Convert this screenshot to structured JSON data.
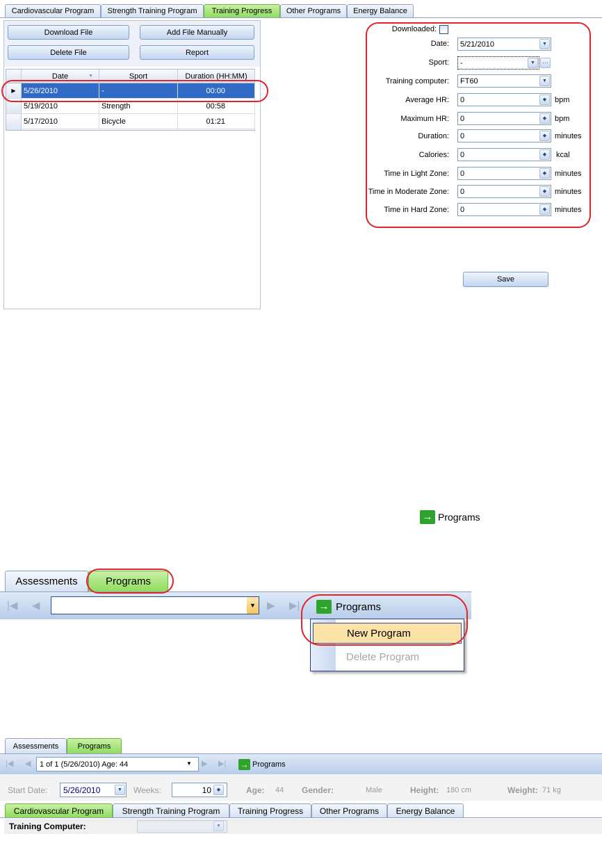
{
  "top": {
    "tabs": [
      {
        "label": "Cardiovascular Program",
        "active": false
      },
      {
        "label": "Strength Training Program",
        "active": false
      },
      {
        "label": "Training Progress",
        "active": true
      },
      {
        "label": "Other Programs",
        "active": false
      },
      {
        "label": "Energy Balance",
        "active": false
      }
    ],
    "buttons": {
      "download": "Download File",
      "add_manual": "Add File Manually",
      "delete": "Delete File",
      "report": "Report"
    },
    "grid": {
      "columns": [
        "Date",
        "Sport",
        "Duration (HH:MM)"
      ],
      "rows": [
        {
          "date": "5/26/2010",
          "sport": "-",
          "duration": "00:00"
        },
        {
          "date": "5/19/2010",
          "sport": "Strength",
          "duration": "00:58"
        },
        {
          "date": "5/17/2010",
          "sport": "Bicycle",
          "duration": "01:21"
        }
      ]
    },
    "form": {
      "downloaded_label": "Downloaded:",
      "date_label": "Date:",
      "date_value": "5/21/2010",
      "sport_label": "Sport:",
      "sport_value": "-",
      "computer_label": "Training computer:",
      "computer_value": "FT60",
      "avg_hr_label": "Average HR:",
      "avg_hr_value": "0",
      "avg_hr_unit": "bpm",
      "max_hr_label": "Maximum HR:",
      "max_hr_value": "0",
      "max_hr_unit": "bpm",
      "duration_label": "Duration:",
      "duration_value": "0",
      "duration_unit": "minutes",
      "calories_label": "Calories:",
      "calories_value": "0",
      "calories_unit": "kcal",
      "light_label": "Time in Light Zone:",
      "light_value": "0",
      "light_unit": "minutes",
      "moderate_label": "Time in Moderate Zone:",
      "moderate_value": "0",
      "moderate_unit": "minutes",
      "hard_label": "Time in Hard Zone:",
      "hard_value": "0",
      "hard_unit": "minutes",
      "save_label": "Save"
    }
  },
  "programs_badge": {
    "label": "Programs",
    "arrow": "→"
  },
  "middle": {
    "tabs": [
      {
        "label": "Assessments",
        "active": false
      },
      {
        "label": "Programs",
        "active": true
      }
    ],
    "programs_button": "Programs",
    "menu": {
      "new_program": "New Program",
      "delete_program": "Delete Program"
    }
  },
  "bottom": {
    "tabs": [
      {
        "label": "Assessments",
        "active": false
      },
      {
        "label": "Programs",
        "active": true
      }
    ],
    "record_value": "1 of 1 (5/26/2010) Age: 44",
    "programs_button": "Programs",
    "start_date_label": "Start Date:",
    "start_date_value": "5/26/2010",
    "weeks_label": "Weeks:",
    "weeks_value": "10",
    "age_label": "Age:",
    "age_value": "44",
    "gender_label": "Gender:",
    "gender_value": "Male",
    "height_label": "Height:",
    "height_value": "180 cm",
    "weight_label": "Weight:",
    "weight_value": "71 kg",
    "tabs2": [
      {
        "label": "Cardiovascular Program",
        "active": true
      },
      {
        "label": "Strength Training Program",
        "active": false
      },
      {
        "label": "Training Progress",
        "active": false
      },
      {
        "label": "Other Programs",
        "active": false
      },
      {
        "label": "Energy Balance",
        "active": false
      }
    ],
    "training_computer_label": "Training Computer:"
  }
}
